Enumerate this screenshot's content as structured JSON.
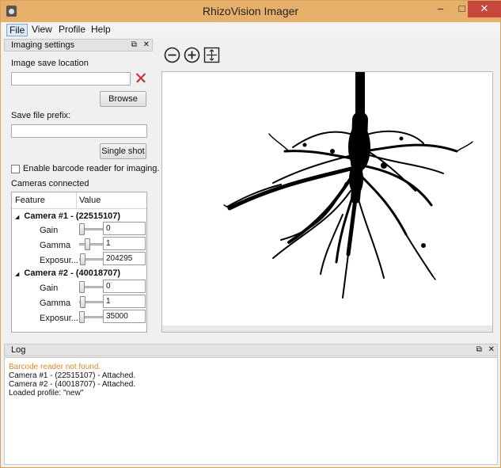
{
  "window": {
    "title": "RhizoVision Imager",
    "minimize_glyph": "–",
    "maximize_glyph": "□",
    "close_glyph": "✕"
  },
  "menu": {
    "items": [
      {
        "label": "File"
      },
      {
        "label": "View"
      },
      {
        "label": "Profile"
      },
      {
        "label": "Help"
      }
    ]
  },
  "imaging_settings": {
    "title": "Imaging settings",
    "float_glyph": "⧉",
    "close_glyph": "✕",
    "save_location_label": "Image save location",
    "save_location_value": "",
    "browse_label": "Browse",
    "prefix_label": "Save file prefix:",
    "prefix_value": "",
    "single_shot_label": "Single shot",
    "barcode_label": "Enable barcode reader for imaging.",
    "barcode_checked": false,
    "cameras_label": "Cameras connected",
    "table": {
      "col_feature": "Feature",
      "col_value": "Value",
      "cameras": [
        {
          "name": "Camera #1 - (22515107)",
          "rows": [
            {
              "feature": "Gain",
              "value": "0",
              "level": 0.0
            },
            {
              "feature": "Gamma",
              "value": "1",
              "level": 0.3
            },
            {
              "feature": "Exposur...",
              "value": "204295",
              "level": 0.05
            }
          ]
        },
        {
          "name": "Camera #2 - (40018707)",
          "rows": [
            {
              "feature": "Gain",
              "value": "0",
              "level": 0.0
            },
            {
              "feature": "Gamma",
              "value": "1",
              "level": 0.05
            },
            {
              "feature": "Exposur...",
              "value": "35000",
              "level": 0.0
            }
          ]
        }
      ]
    }
  },
  "toolbar": {
    "zoom_out_icon": "zoom-out-icon",
    "zoom_in_icon": "zoom-in-icon",
    "fit_icon": "fit-to-window-icon"
  },
  "log": {
    "title": "Log",
    "float_glyph": "⧉",
    "close_glyph": "✕",
    "lines": [
      {
        "text": "Barcode reader not found.",
        "kind": "warning",
        "color": "#e08a1e"
      },
      {
        "text": "Camera #1 - (22515107) - Attached.",
        "kind": "info"
      },
      {
        "text": "Camera #2 - (40018707) - Attached.",
        "kind": "info"
      },
      {
        "text": "Loaded profile:  \"new\"",
        "kind": "info"
      }
    ]
  },
  "colors": {
    "titlebar": "#e6b06b",
    "close_button": "#c7473c",
    "warning_text": "#e08a1e"
  }
}
